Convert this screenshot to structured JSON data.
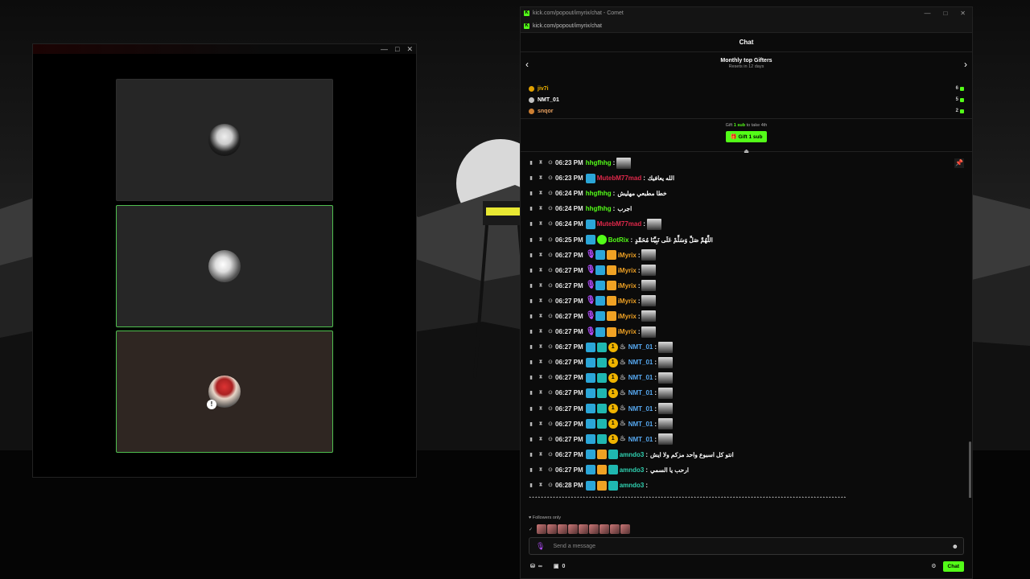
{
  "call_window": {
    "controls": [
      "—",
      "□",
      "✕"
    ]
  },
  "browser": {
    "title": "kick.com/popout/imyrix/chat - Comet",
    "url": "kick.com/popout/imyrix/chat",
    "controls": [
      "—",
      "□",
      "✕"
    ]
  },
  "chat": {
    "header": "Chat",
    "gifters_title": "Monthly top Gifters",
    "gifters_sub": "Resets in 12 days",
    "gifters": [
      {
        "name": "jiv7i",
        "count": "6",
        "color": "#f0b400",
        "medal": "#e0a000"
      },
      {
        "name": "NMT_01",
        "count": "5",
        "color": "#ffffff",
        "medal": "#c0c0c0"
      },
      {
        "name": "snqor",
        "count": "2",
        "color": "#e8a060",
        "medal": "#cd7f32"
      }
    ],
    "gift_line_prefix": "Gift",
    "gift_line_bold": "1 sub",
    "gift_line_suffix": "to take 4th",
    "gift_button": "Gift 1 sub",
    "followers_only": "Followers only",
    "placeholder": "Send a message",
    "count_a": "∞",
    "count_b": "0",
    "chat_button": "Chat"
  },
  "messages": [
    {
      "time": "06:23 PM",
      "user": "hhgfhhg",
      "color": "#53fc18",
      "badges": [],
      "text": "",
      "emote": true
    },
    {
      "time": "06:23 PM",
      "user": "MutebM77mad",
      "color": "#e0284a",
      "badges": [
        "blue"
      ],
      "text": "الله يعافيك",
      "emote": false
    },
    {
      "time": "06:24 PM",
      "user": "hhgfhhg",
      "color": "#53fc18",
      "badges": [],
      "text": "خطا مطبعي مهليش",
      "emote": false
    },
    {
      "time": "06:24 PM",
      "user": "hhgfhhg",
      "color": "#53fc18",
      "badges": [],
      "text": "اجرب",
      "emote": false
    },
    {
      "time": "06:24 PM",
      "user": "MutebM77mad",
      "color": "#e0284a",
      "badges": [
        "blue"
      ],
      "text": "",
      "emote": true
    },
    {
      "time": "06:25 PM",
      "user": "BotRix",
      "color": "#53fc18",
      "badges": [
        "blue",
        "bot"
      ],
      "text": "اللَّهُمَّ صَلِّ وَسَلِّمْ عَلَى نَبِيِّنَا مُحَمَّدٍ",
      "emote": false
    },
    {
      "time": "06:27 PM",
      "user": "iMyrix",
      "color": "#f0a224",
      "badges": [
        "mic",
        "blue",
        "crown"
      ],
      "text": "",
      "emote": true
    },
    {
      "time": "06:27 PM",
      "user": "iMyrix",
      "color": "#f0a224",
      "badges": [
        "mic",
        "blue",
        "crown"
      ],
      "text": "",
      "emote": true
    },
    {
      "time": "06:27 PM",
      "user": "iMyrix",
      "color": "#f0a224",
      "badges": [
        "mic",
        "blue",
        "crown"
      ],
      "text": "",
      "emote": true
    },
    {
      "time": "06:27 PM",
      "user": "iMyrix",
      "color": "#f0a224",
      "badges": [
        "mic",
        "blue",
        "crown"
      ],
      "text": "",
      "emote": true
    },
    {
      "time": "06:27 PM",
      "user": "iMyrix",
      "color": "#f0a224",
      "badges": [
        "mic",
        "blue",
        "crown"
      ],
      "text": "",
      "emote": true
    },
    {
      "time": "06:27 PM",
      "user": "iMyrix",
      "color": "#f0a224",
      "badges": [
        "mic",
        "blue",
        "crown"
      ],
      "text": "",
      "emote": true
    },
    {
      "time": "06:27 PM",
      "user": "NMT_01",
      "color": "#56a8f0",
      "badges": [
        "blue",
        "teal",
        "coin",
        "flame"
      ],
      "text": "",
      "emote": true
    },
    {
      "time": "06:27 PM",
      "user": "NMT_01",
      "color": "#56a8f0",
      "badges": [
        "blue",
        "teal",
        "coin",
        "flame"
      ],
      "text": "",
      "emote": true
    },
    {
      "time": "06:27 PM",
      "user": "NMT_01",
      "color": "#56a8f0",
      "badges": [
        "blue",
        "teal",
        "coin",
        "flame"
      ],
      "text": "",
      "emote": true
    },
    {
      "time": "06:27 PM",
      "user": "NMT_01",
      "color": "#56a8f0",
      "badges": [
        "blue",
        "teal",
        "coin",
        "flame"
      ],
      "text": "",
      "emote": true
    },
    {
      "time": "06:27 PM",
      "user": "NMT_01",
      "color": "#56a8f0",
      "badges": [
        "blue",
        "teal",
        "coin",
        "flame"
      ],
      "text": "",
      "emote": true
    },
    {
      "time": "06:27 PM",
      "user": "NMT_01",
      "color": "#56a8f0",
      "badges": [
        "blue",
        "teal",
        "coin",
        "flame"
      ],
      "text": "",
      "emote": true
    },
    {
      "time": "06:27 PM",
      "user": "NMT_01",
      "color": "#56a8f0",
      "badges": [
        "blue",
        "teal",
        "coin",
        "flame"
      ],
      "text": "",
      "emote": true
    },
    {
      "time": "06:27 PM",
      "user": "amndo3",
      "color": "#2fd0b0",
      "badges": [
        "blue",
        "crown",
        "teal"
      ],
      "text": "انتو كل اسبوع واحد مزكم ولا ايش",
      "emote": false
    },
    {
      "time": "06:27 PM",
      "user": "amndo3",
      "color": "#2fd0b0",
      "badges": [
        "blue",
        "crown",
        "teal"
      ],
      "text": "ارحب يا السمي",
      "emote": false
    },
    {
      "time": "06:28 PM",
      "user": "amndo3",
      "color": "#2fd0b0",
      "badges": [
        "blue",
        "crown",
        "teal"
      ],
      "text": "",
      "emote": false
    }
  ],
  "spam_line_1": "ﻎﻎﻎﻎﻎﻎﻎﻎﻎﻎﻎﻎﻎﻎﻎﻎﻎﻎﻎﻎﻎﻎﻎﻎﻎﻎﻎﻎﻎﻎﻎﻎﻎﻎﻎﻎﻎﻎﻎﻎﻎﻎﻎﻎﻎﻎﻎﻎﻎﻎﻎﻎﻎﻎﻎﻎﻎﻎﻎﻎﻎﻎﻎﻎﻎﻎﻎﻎﻎﻎﻎﻎﻎﻎﻎﻎﻎﻎﻎﻎﻎﻎﻎﻎﻎﻎﻎﻎﻎﻎﻎﻎﻎﻎﻎﻎﻎﻎﻎﻎﻎﻎﻎﻎﻎﻎ",
  "spam_line_2": "ﻎﻎﻎﻎﻎﻎﻎﻎﻎﻎﻎﻎﻎﻎﻎﻎﻎﻎﻎﻎﻎﻎﻎﻎﻎﻎﻎﻎﻎ"
}
